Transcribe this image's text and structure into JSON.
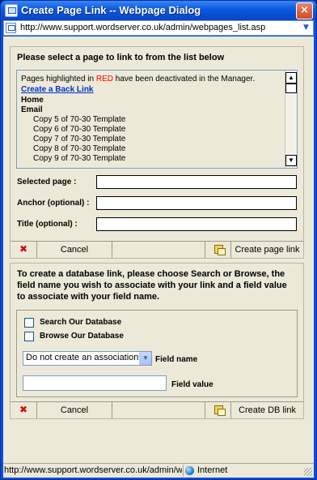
{
  "window": {
    "title": "Create Page Link -- Webpage Dialog",
    "close_glyph": "×",
    "close_icon": "close-icon"
  },
  "address": {
    "url": "http://www.support.wordserver.co.uk/admin/webpages_list.asp",
    "icon": "page-icon"
  },
  "page_link": {
    "heading": "Please select a page to link to from the list below",
    "note_prefix": "Pages highlighted in ",
    "note_red": "RED",
    "note_suffix": " have been deactivated in the Manager.",
    "back_link": "Create a Back Link",
    "pages": [
      {
        "label": "Home",
        "level": 0
      },
      {
        "label": "Email",
        "level": 0
      },
      {
        "label": "Copy 5 of 70-30 Template",
        "level": 1
      },
      {
        "label": "Copy 6 of 70-30 Template",
        "level": 1
      },
      {
        "label": "Copy 7 of 70-30 Template",
        "level": 1
      },
      {
        "label": "Copy 8 of 70-30 Template",
        "level": 1
      },
      {
        "label": "Copy 9 of 70-30 Template",
        "level": 1
      }
    ],
    "fields": {
      "selected_page_label": "Selected page :",
      "selected_page_value": "",
      "anchor_label": "Anchor (optional) :",
      "anchor_value": "",
      "title_label": "Title (optional) :",
      "title_value": ""
    },
    "buttons": {
      "delete_glyph": "✖",
      "cancel": "Cancel",
      "create": "Create page link"
    }
  },
  "db_link": {
    "heading": "To create a database link, please choose Search or Browse, the field name you wish to associate with your link and a field value to associate with your field name.",
    "search_label": "Search Our Database",
    "search_checked": false,
    "browse_label": "Browse Our Database",
    "browse_checked": false,
    "association_selected": "Do not create an association",
    "field_name_label": "Field name",
    "field_value_label": "Field value",
    "field_value": "",
    "buttons": {
      "delete_glyph": "✖",
      "cancel": "Cancel",
      "create": "Create DB link"
    }
  },
  "status": {
    "url": "http://www.support.wordserver.co.uk/admin/webpa",
    "zone": "Internet"
  },
  "colors": {
    "title_bar": "#0a58e0",
    "dialog_bg": "#ece9d8",
    "deactivated": "#ff0000",
    "link": "#0033cc",
    "delete": "#cc1111"
  }
}
